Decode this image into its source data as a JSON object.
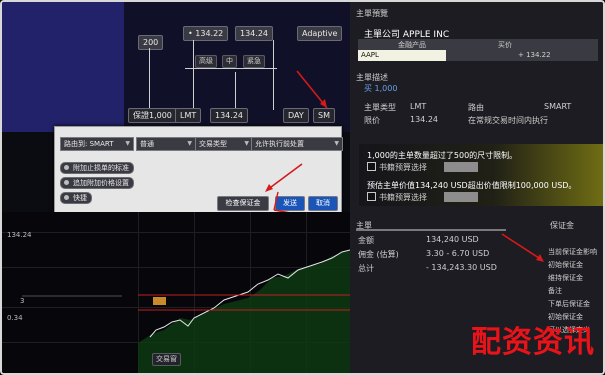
{
  "toolbar": {
    "qty_main": "200",
    "limit_price_1": "• 134.22",
    "limit_price_2": "134.24",
    "algo_select": "Adaptive",
    "sub_btn_1": "高级",
    "sub_btn_2": "中",
    "sub_btn_3": "紧急",
    "order_qty_label": "保證1,000",
    "order_type": "LMT",
    "order_price": "134.24",
    "tif": "DAY",
    "routing": "SM"
  },
  "dialog": {
    "routing_select": "路由到: SMART",
    "field_2": "普通",
    "field_3": "交易类型",
    "field_4": "允许执行前处置",
    "checkbox_1": "附加止损单的标准",
    "checkbox_2": "追加附加价格设置",
    "checkbox_3": "快捷",
    "btn_confirm": "检查保证金",
    "btn_transmit": "发送",
    "btn_cancel": "取消"
  },
  "right_panel": {
    "section_1_title": "主單預覽",
    "stock_label": "主單公司 APPLE INC",
    "col_product": "金融产品",
    "col_bid": "买价",
    "symbol": "AAPL",
    "price": "+ 134.22",
    "section_2_title": "主單描述",
    "section_2_sub": "买 1,000",
    "order_type_label": "主單类型",
    "order_type_val": "LMT",
    "routing_label": "路由",
    "routing_val": "SMART",
    "price_label": "限价",
    "price_val": "134.24",
    "tif_label": "在常规交易时间内执行",
    "warn_1": "1,000的主单数量超过了500的尺寸限制。",
    "warn_check_1": "书籍预算选择",
    "warn_2": "预估主单价值134,240 USD超出价值限制100,000 USD。",
    "warn_check_2": "书籍预算选择",
    "section_3_title": "主單",
    "amount_label": "金额",
    "amount_val": "134,240 USD",
    "commission_label": "佣金 (估算)",
    "commission_val": "3.30 - 6.70 USD",
    "total_label": "总计",
    "total_val": "- 134,243.30 USD",
    "side_1": "保证金",
    "side_2": "当前保证金影响",
    "side_3": "初始保证金",
    "side_4": "维持保证金",
    "side_5": "备注",
    "side_6": "下单后保证金",
    "side_7": "初始保证金",
    "side_8": "可以选择定义"
  },
  "chart": {
    "price_top": "134.24",
    "price_mid": "3",
    "price_low": "0.34",
    "button_label": "交易窗"
  },
  "watermark": "配资资讯"
}
